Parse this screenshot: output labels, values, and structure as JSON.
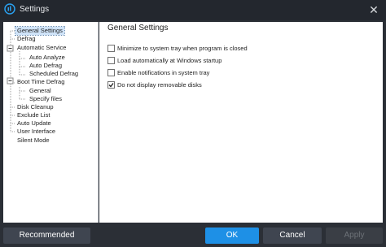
{
  "window": {
    "title": "Settings",
    "close_glyph": "✕"
  },
  "tree": {
    "items": [
      {
        "label": "General Settings"
      },
      {
        "label": "Defrag"
      },
      {
        "label": "Automatic Service"
      },
      {
        "label": "Auto Analyze"
      },
      {
        "label": "Auto Defrag"
      },
      {
        "label": "Scheduled Defrag"
      },
      {
        "label": "Boot Time Defrag"
      },
      {
        "label": "General"
      },
      {
        "label": "Specify files"
      },
      {
        "label": "Disk Cleanup"
      },
      {
        "label": "Exclude List"
      },
      {
        "label": "Auto Update"
      },
      {
        "label": "User Interface"
      },
      {
        "label": "Silent Mode"
      }
    ],
    "selected": "General Settings"
  },
  "content": {
    "title": "General Settings",
    "options": [
      {
        "label": "Minimize to system tray when program is closed",
        "checked": false
      },
      {
        "label": "Load automatically at Windows startup",
        "checked": false
      },
      {
        "label": "Enable notifications in system tray",
        "checked": false
      },
      {
        "label": "Do not display removable disks",
        "checked": true
      }
    ]
  },
  "footer": {
    "recommended_label": "Recommended",
    "ok_label": "OK",
    "cancel_label": "Cancel",
    "apply_label": "Apply"
  },
  "colors": {
    "titlebar": "#23272e",
    "footer": "#2b2f36",
    "accent": "#1e90e6",
    "selection": "#cfe3f8"
  }
}
